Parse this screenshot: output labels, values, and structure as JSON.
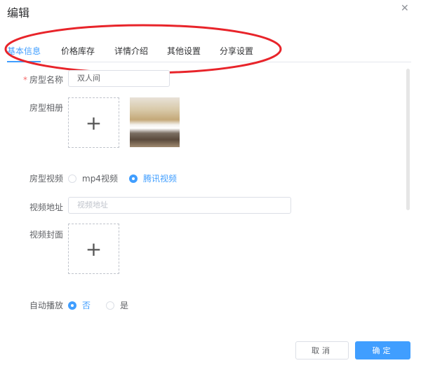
{
  "dialog": {
    "title": "编辑",
    "close_icon": "close-icon"
  },
  "tabs": [
    {
      "label": "基本信息",
      "active": true
    },
    {
      "label": "价格库存"
    },
    {
      "label": "详情介绍"
    },
    {
      "label": "其他设置"
    },
    {
      "label": "分享设置"
    }
  ],
  "form": {
    "room_name": {
      "label": "房型名称",
      "value": "双人间",
      "required_mark": "*"
    },
    "album": {
      "label": "房型相册",
      "add": "+"
    },
    "video": {
      "label": "房型视频",
      "options": [
        "mp4视频",
        "腾讯视频"
      ],
      "selected": "腾讯视频"
    },
    "video_url": {
      "label": "视频地址",
      "placeholder": "视频地址"
    },
    "cover": {
      "label": "视频封面",
      "add": "+"
    },
    "autoplay": {
      "label": "自动播放",
      "options": [
        "否",
        "是"
      ],
      "selected": "否"
    }
  },
  "footer": {
    "cancel": "取消",
    "confirm": "确定"
  },
  "colors": {
    "primary": "#409eff",
    "annotation": "#e8242a"
  }
}
